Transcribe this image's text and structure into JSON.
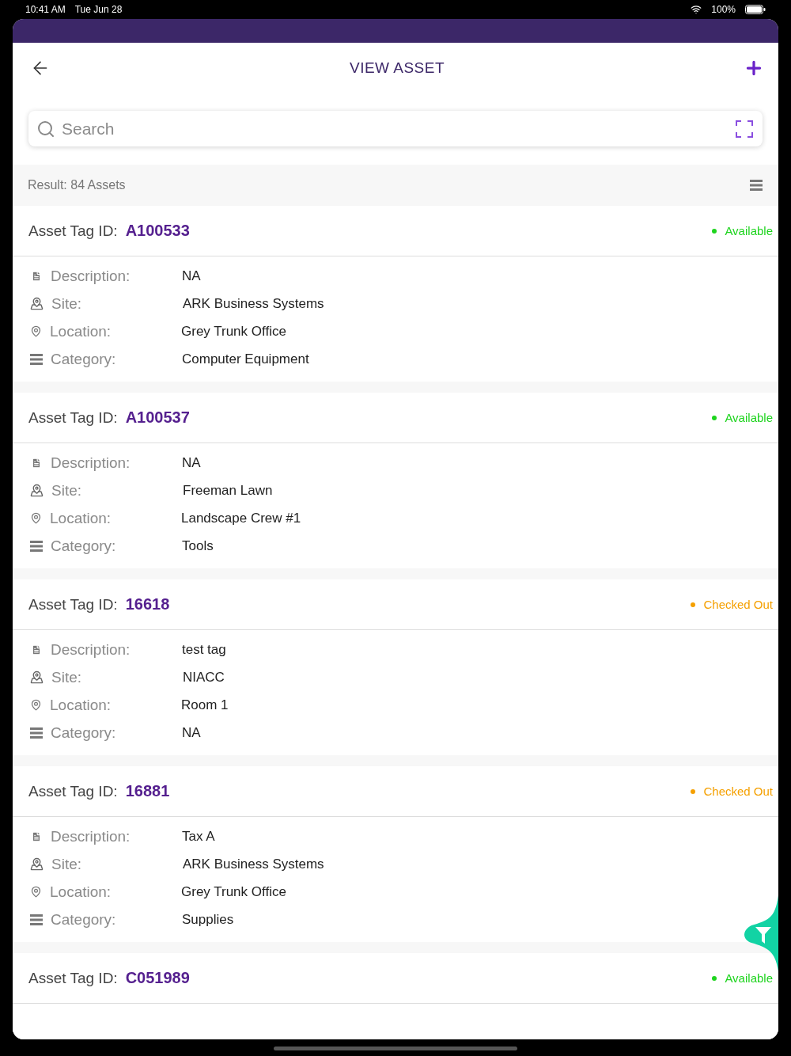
{
  "status_bar": {
    "time": "10:41 AM",
    "date": "Tue Jun 28",
    "battery": "100%"
  },
  "header": {
    "title": "VIEW ASSET"
  },
  "search": {
    "placeholder": "Search"
  },
  "result": {
    "text": "Result: 84 Assets"
  },
  "assets": [
    {
      "tag_label": "Asset Tag ID:",
      "tag_id": "A100533",
      "status": {
        "text": "Available",
        "color": "#1ed41e"
      },
      "fields": [
        {
          "kind": "description",
          "label": "Description:",
          "value": "NA"
        },
        {
          "kind": "site",
          "label": "Site:",
          "value": "ARK Business Systems"
        },
        {
          "kind": "location",
          "label": "Location:",
          "value": "Grey Trunk Office"
        },
        {
          "kind": "category",
          "label": "Category:",
          "value": "Computer Equipment"
        }
      ]
    },
    {
      "tag_label": "Asset Tag ID:",
      "tag_id": "A100537",
      "status": {
        "text": "Available",
        "color": "#1ed41e"
      },
      "fields": [
        {
          "kind": "description",
          "label": "Description:",
          "value": "NA"
        },
        {
          "kind": "site",
          "label": "Site:",
          "value": "Freeman Lawn"
        },
        {
          "kind": "location",
          "label": "Location:",
          "value": "Landscape Crew #1"
        },
        {
          "kind": "category",
          "label": "Category:",
          "value": "Tools"
        }
      ]
    },
    {
      "tag_label": "Asset Tag ID:",
      "tag_id": "16618",
      "status": {
        "text": "Checked Out",
        "color": "#f5a000"
      },
      "fields": [
        {
          "kind": "description",
          "label": "Description:",
          "value": "test tag"
        },
        {
          "kind": "site",
          "label": "Site:",
          "value": "NIACC"
        },
        {
          "kind": "location",
          "label": "Location:",
          "value": "Room 1"
        },
        {
          "kind": "category",
          "label": "Category:",
          "value": "NA"
        }
      ]
    },
    {
      "tag_label": "Asset Tag ID:",
      "tag_id": "16881",
      "status": {
        "text": "Checked Out",
        "color": "#f5a000"
      },
      "fields": [
        {
          "kind": "description",
          "label": "Description:",
          "value": "Tax A"
        },
        {
          "kind": "site",
          "label": "Site:",
          "value": "ARK Business Systems"
        },
        {
          "kind": "location",
          "label": "Location:",
          "value": "Grey Trunk Office"
        },
        {
          "kind": "category",
          "label": "Category:",
          "value": "Supplies"
        }
      ]
    },
    {
      "tag_label": "Asset Tag ID:",
      "tag_id": "C051989",
      "status": {
        "text": "Available",
        "color": "#1ed41e"
      }
    }
  ]
}
